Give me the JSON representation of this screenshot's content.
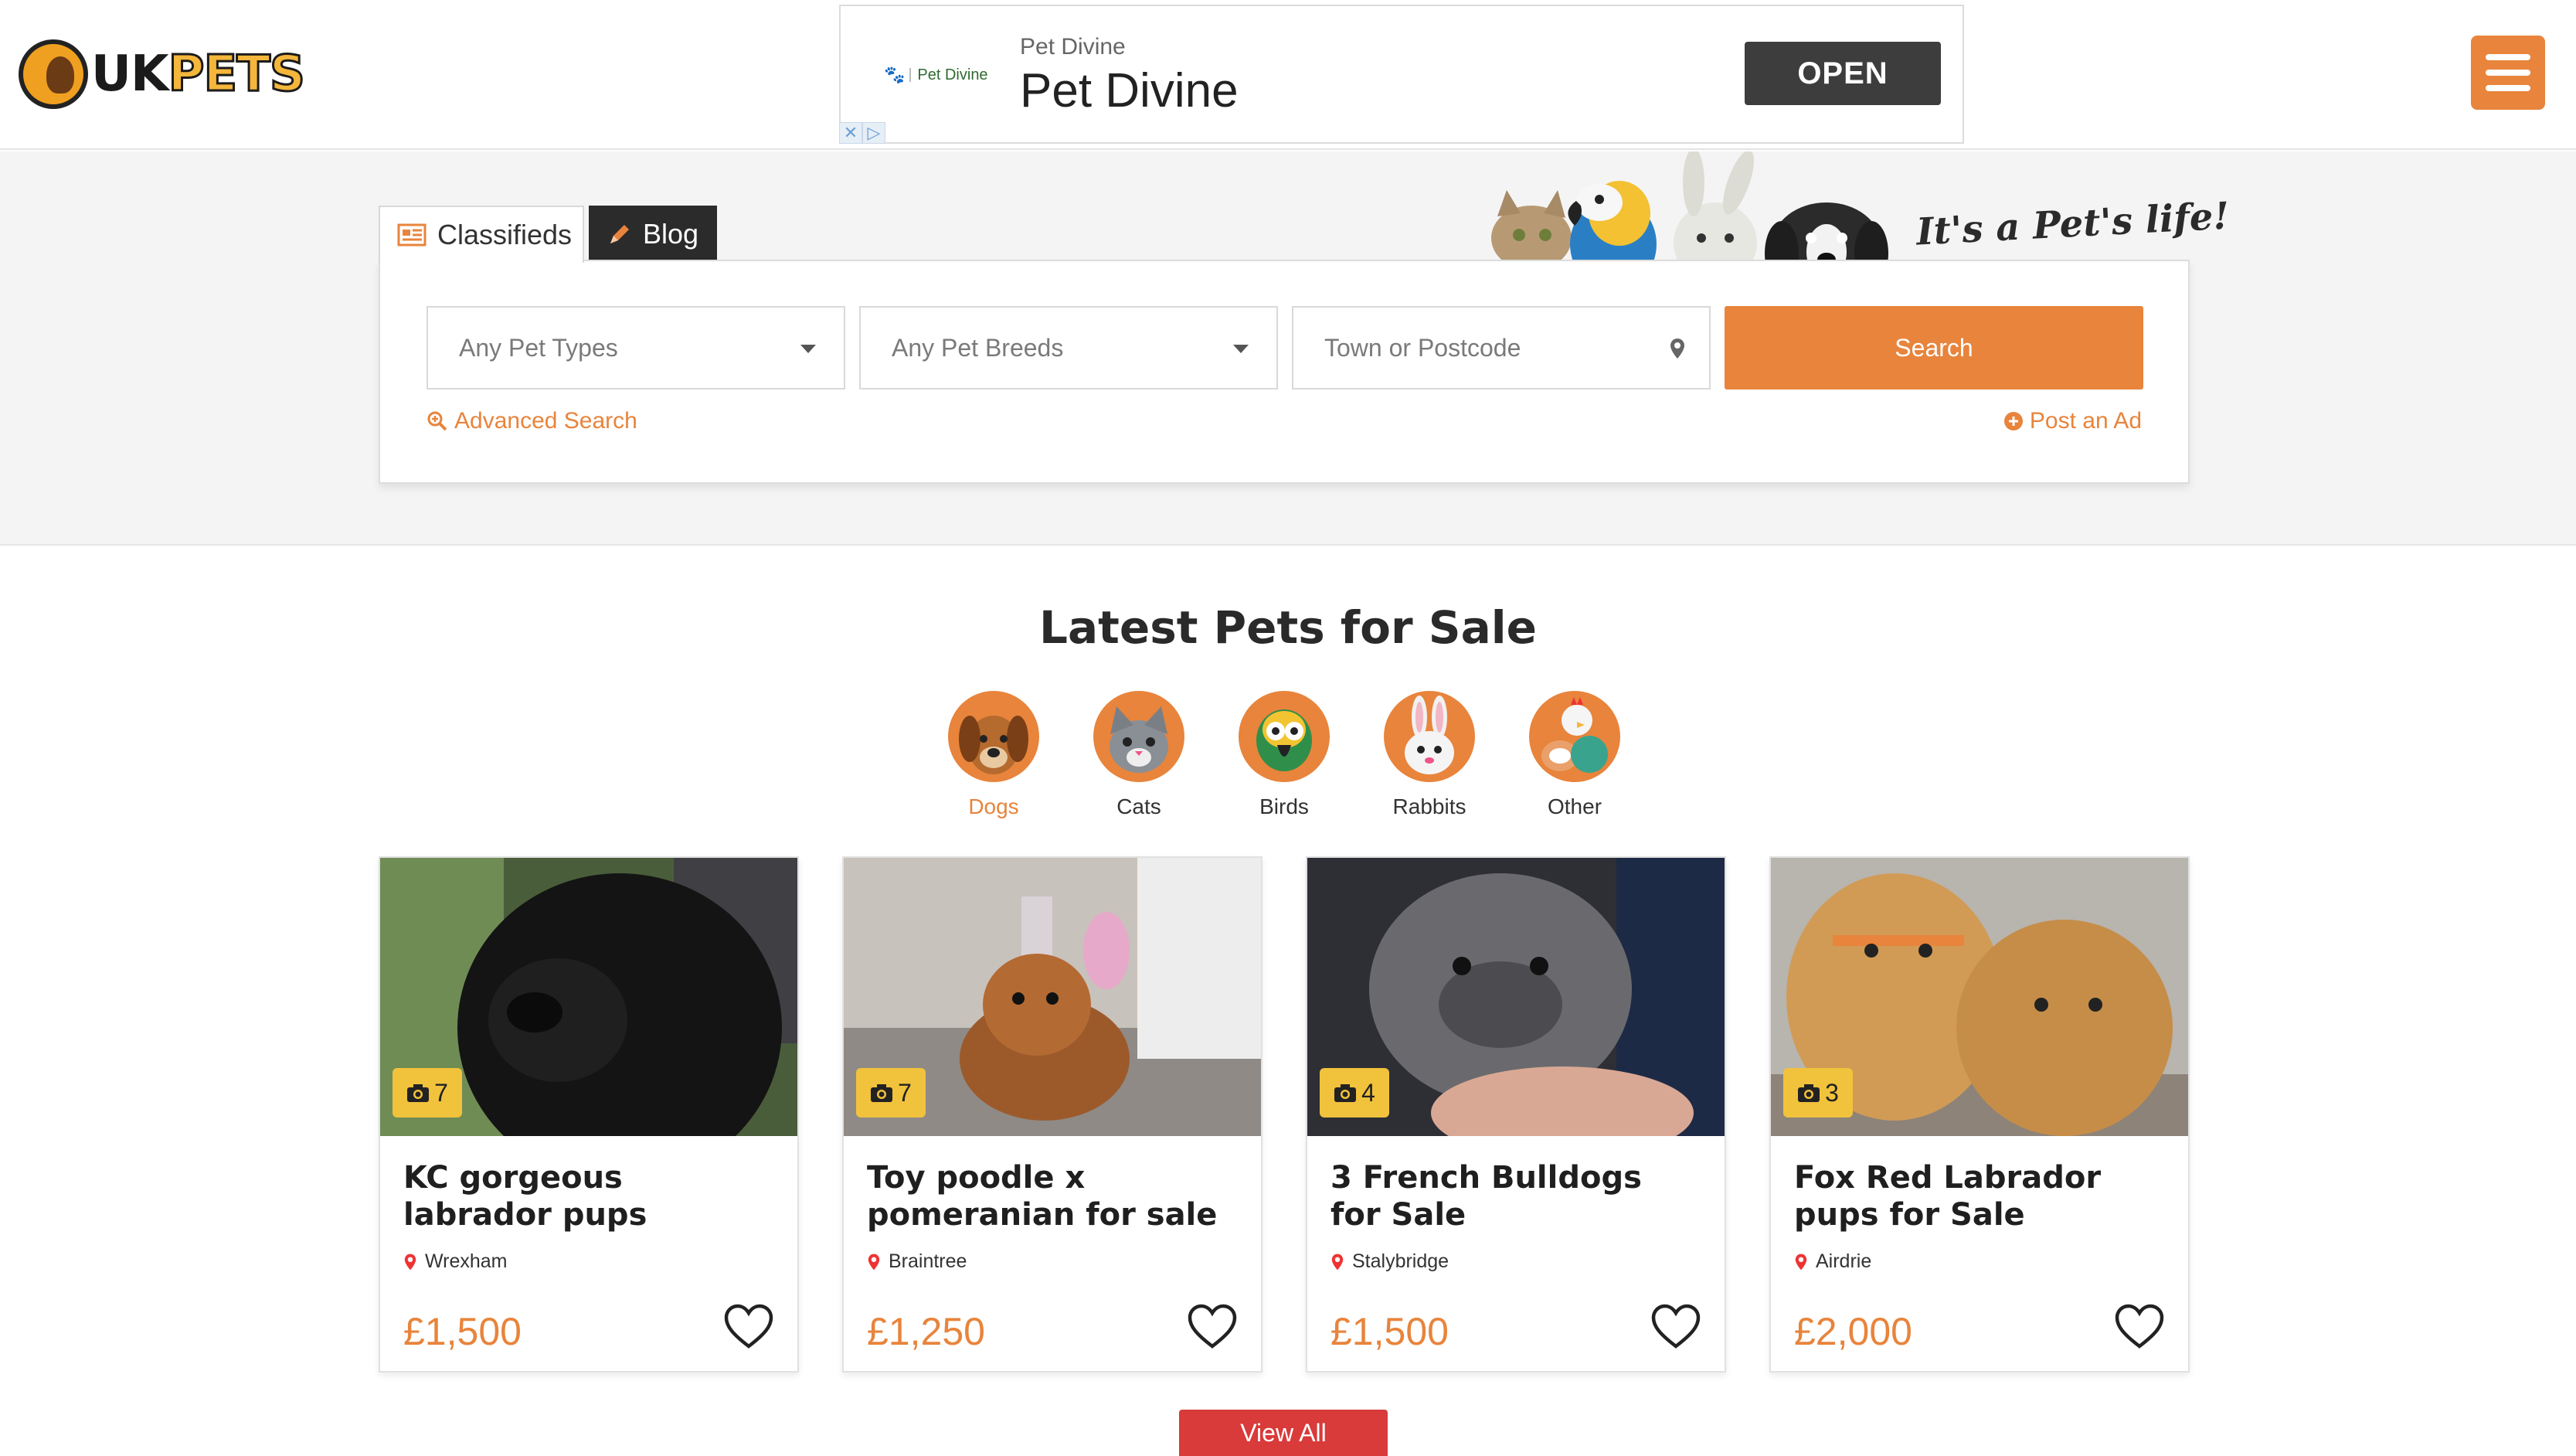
{
  "header": {
    "logo_text_uk": "UK",
    "logo_text_pets": "PETS",
    "menu_icon": "hamburger-icon"
  },
  "ad": {
    "logo_text": "Pet Divine",
    "advertiser_small": "Pet Divine",
    "advertiser_big": "Pet Divine",
    "cta_label": "OPEN",
    "choices_icons": [
      "close-icon",
      "adchoices-icon"
    ]
  },
  "search": {
    "tabs": [
      {
        "label": "Classifieds",
        "icon": "newspaper-icon"
      },
      {
        "label": "Blog",
        "icon": "pencil-icon"
      }
    ],
    "tagline": "It's a Pet's life!",
    "pet_type_value": "Any Pet Types",
    "pet_breed_value": "Any Pet Breeds",
    "location_placeholder": "Town or Postcode",
    "search_label": "Search",
    "advanced_search_label": "Advanced Search",
    "post_ad_label": "Post an Ad"
  },
  "latest": {
    "title": "Latest Pets for Sale",
    "categories": [
      {
        "label": "Dogs",
        "icon": "dog-icon",
        "active": true
      },
      {
        "label": "Cats",
        "icon": "cat-icon",
        "active": false
      },
      {
        "label": "Birds",
        "icon": "parrot-icon",
        "active": false
      },
      {
        "label": "Rabbits",
        "icon": "rabbit-icon",
        "active": false
      },
      {
        "label": "Other",
        "icon": "other-pets-icon",
        "active": false
      }
    ],
    "listings": [
      {
        "title": "KC gorgeous labrador pups",
        "location": "Wrexham",
        "price": "£1,500",
        "photos": "7"
      },
      {
        "title": "Toy poodle x pomeranian for sale",
        "location": "Braintree",
        "price": "£1,250",
        "photos": "7"
      },
      {
        "title": "3 French Bulldogs for Sale",
        "location": "Stalybridge",
        "price": "£1,500",
        "photos": "4"
      },
      {
        "title": "Fox Red Labrador pups for Sale",
        "location": "Airdrie",
        "price": "£2,000",
        "photos": "3"
      }
    ],
    "view_all_label": "View All"
  },
  "colors": {
    "accent": "#e8843c",
    "dark": "#2b2b2b",
    "badge": "#f1c23c",
    "view_all": "#d93a3a"
  }
}
